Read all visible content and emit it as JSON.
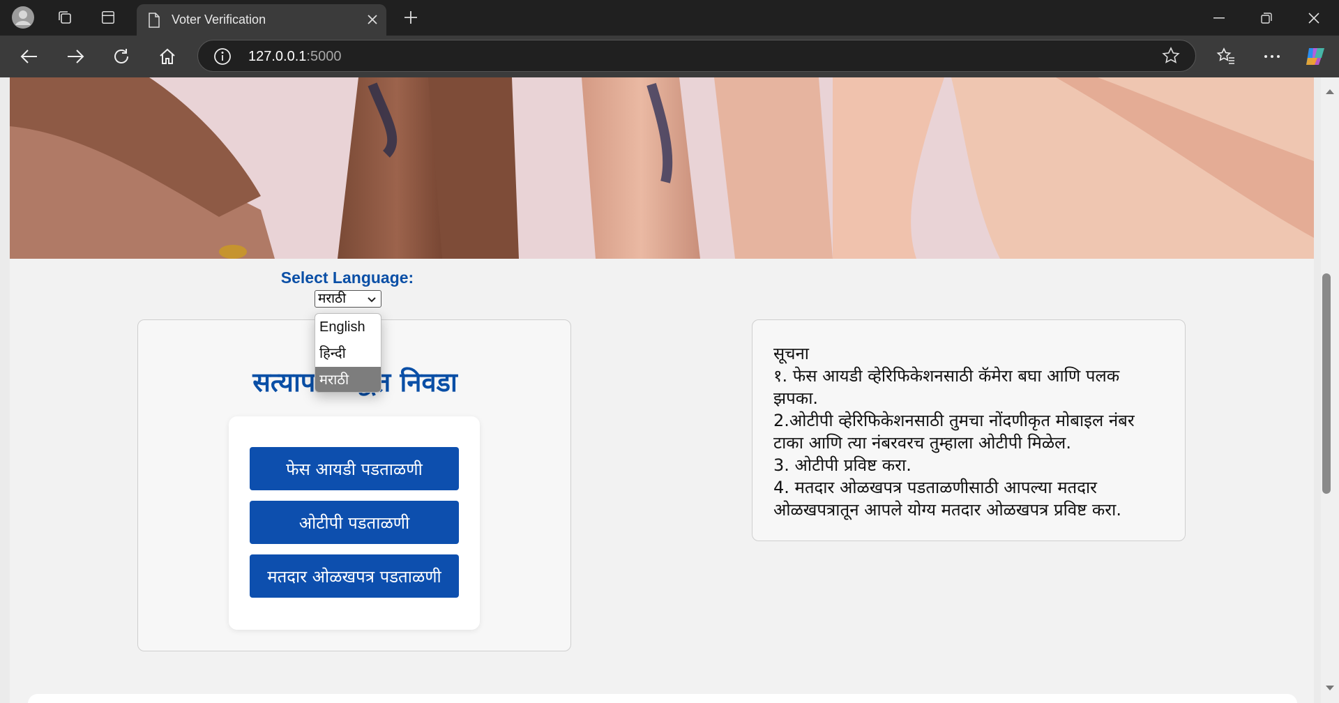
{
  "browser": {
    "tab_title": "Voter Verification",
    "url_host": "127.0.0.1",
    "url_port": ":5000"
  },
  "page": {
    "language_label": "Select Language:",
    "language_selected": "मराठी",
    "language_options": [
      "English",
      "हिन्दी",
      "मराठी"
    ],
    "method_title": "सत्यापन पद्धत निवडा",
    "buttons": {
      "face": "फेस आयडी पडताळणी",
      "otp": "ओटीपी पडताळणी",
      "voter_id": "मतदार ओळखपत्र पडताळणी"
    },
    "notice": {
      "heading": "सूचना",
      "lines": [
        "१. फेस आयडी व्हेरिफिकेशनसाठी कॅमेरा बघा आणि पलक झपका.",
        "2.ओटीपी व्हेरिफिकेशनसाठी तुमचा नोंदणीकृत मोबाइल नंबर टाका आणि त्या नंबरवरच तुम्हाला ओटीपी मिळेल.",
        "3. ओटीपी प्रविष्ट करा.",
        "4. मतदार ओळखपत्र पडताळणीसाठी आपल्या मतदार ओळखपत्रातून आपले योग्य मतदार ओळखपत्र प्रविष्ट करा."
      ]
    }
  }
}
